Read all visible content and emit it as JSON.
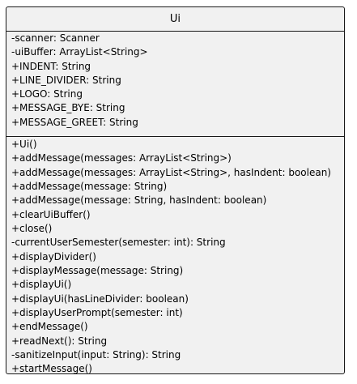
{
  "class": {
    "name": "Ui",
    "fields": [
      "-scanner: Scanner",
      "-uiBuffer: ArrayList<String>",
      "+INDENT: String",
      "+LINE_DIVIDER: String",
      "+LOGO: String",
      "+MESSAGE_BYE: String",
      "+MESSAGE_GREET: String"
    ],
    "methods": [
      "+Ui()",
      "+addMessage(messages: ArrayList<String>)",
      "+addMessage(messages: ArrayList<String>, hasIndent: boolean)",
      "+addMessage(message: String)",
      "+addMessage(message: String, hasIndent: boolean)",
      "+clearUiBuffer()",
      "+close()",
      "-currentUserSemester(semester: int): String",
      "+displayDivider()",
      "+displayMessage(message: String)",
      "+displayUi()",
      "+displayUi(hasLineDivider: boolean)",
      "+displayUserPrompt(semester: int)",
      "+endMessage()",
      "+readNext(): String",
      "-sanitizeInput(input: String): String",
      "+startMessage()"
    ]
  }
}
